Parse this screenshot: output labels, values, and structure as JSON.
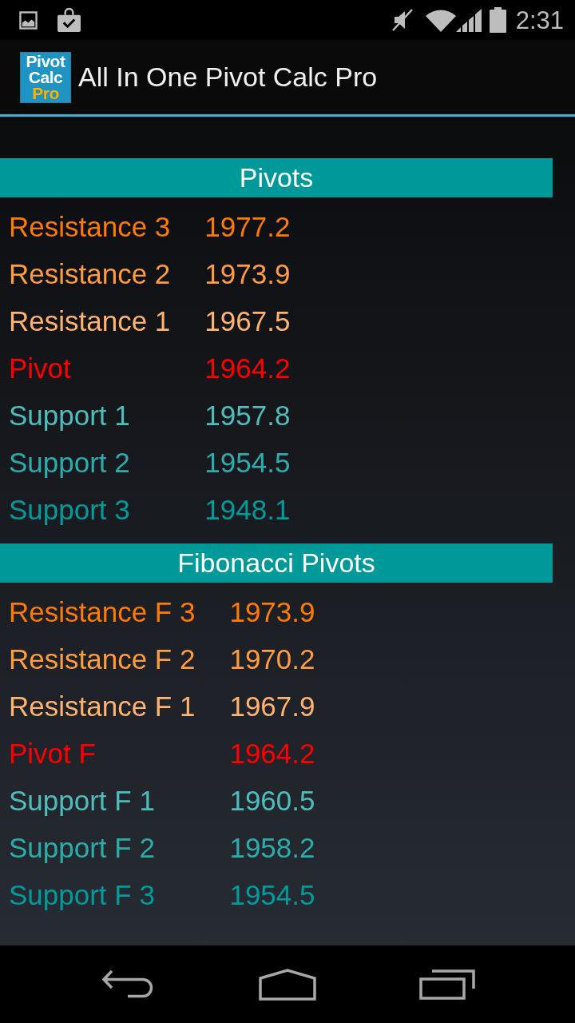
{
  "status_bar": {
    "time": "2:31"
  },
  "action_bar": {
    "app_icon": {
      "lines": [
        {
          "text": "Pivot",
          "color": "#ffffff"
        },
        {
          "text": "Calc",
          "color": "#ffffff"
        },
        {
          "text": "Pro",
          "color": "#ffb000"
        }
      ]
    },
    "title": "All In One Pivot Calc Pro"
  },
  "sections": [
    {
      "title": "Pivots",
      "rows": [
        {
          "label": "Resistance 3",
          "value": "1977.2",
          "color": "#ff7b00"
        },
        {
          "label": "Resistance 2",
          "value": "1973.9",
          "color": "#ff9c3d"
        },
        {
          "label": "Resistance 1",
          "value": "1967.5",
          "color": "#ffb36e"
        },
        {
          "label": "Pivot",
          "value": "1964.2",
          "color": "#ff0000"
        },
        {
          "label": "Support 1",
          "value": "1957.8",
          "color": "#4dbdbd"
        },
        {
          "label": "Support 2",
          "value": "1954.5",
          "color": "#2badad"
        },
        {
          "label": "Support 3",
          "value": "1948.1",
          "color": "#009c9c"
        }
      ]
    },
    {
      "title": "Fibonacci Pivots",
      "rows": [
        {
          "label": "Resistance F 3",
          "value": "1973.9",
          "color": "#ff7b00"
        },
        {
          "label": "Resistance F 2",
          "value": "1970.2",
          "color": "#ff9c3d"
        },
        {
          "label": "Resistance F 1",
          "value": "1967.9",
          "color": "#ffb36e"
        },
        {
          "label": "Pivot F",
          "value": "1964.2",
          "color": "#ff0000"
        },
        {
          "label": "Support F 1",
          "value": "1960.5",
          "color": "#4dbdbd"
        },
        {
          "label": "Support F 2",
          "value": "1958.2",
          "color": "#2badad"
        },
        {
          "label": "Support F 3",
          "value": "1954.5",
          "color": "#009c9c"
        }
      ]
    }
  ]
}
